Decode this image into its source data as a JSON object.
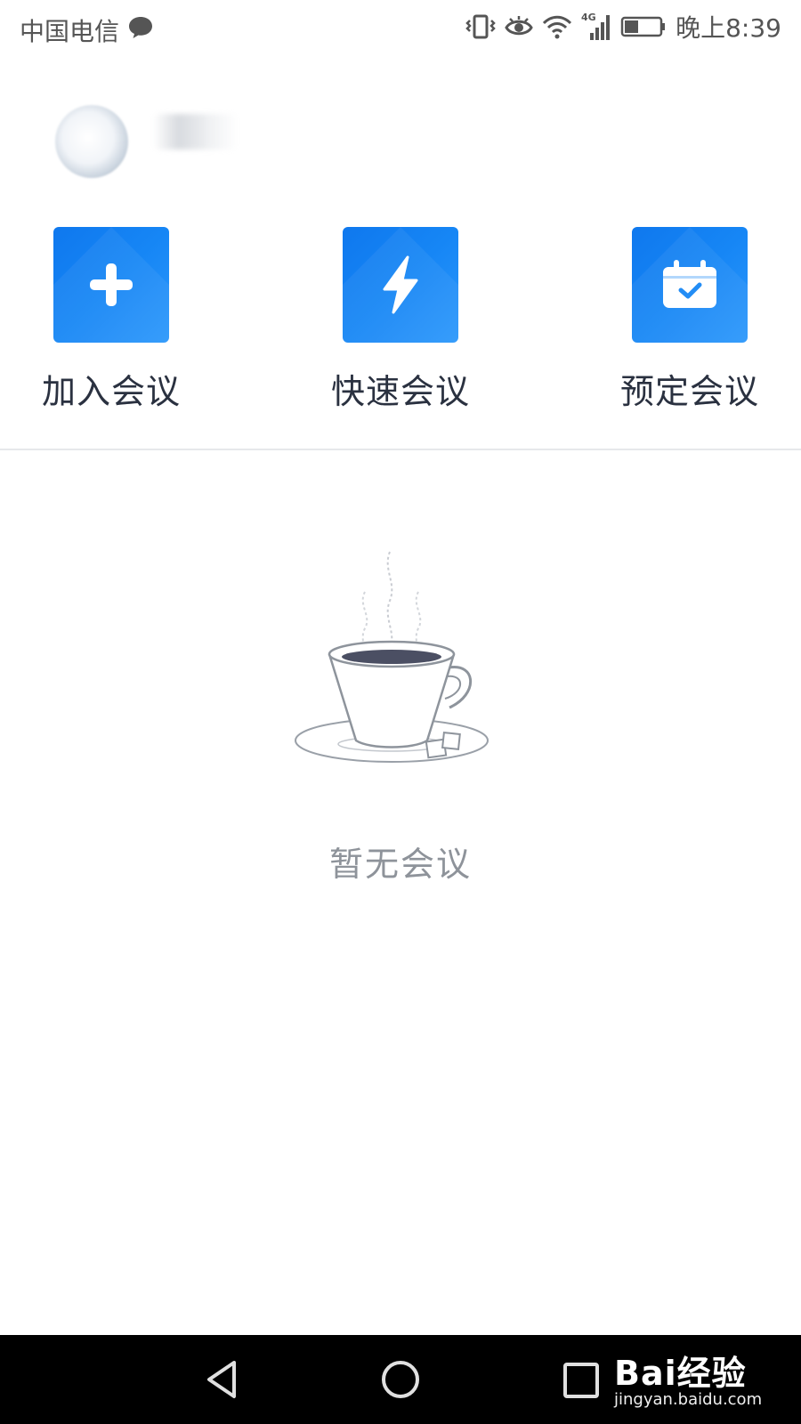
{
  "status_bar": {
    "carrier": "中国电信",
    "time": "晚上8:39",
    "network_label": "4G",
    "icons": [
      "message-icon",
      "vibrate-icon",
      "eye-icon",
      "wifi-icon",
      "signal-icon",
      "battery-icon"
    ]
  },
  "profile": {
    "avatar": "avatar-blurred",
    "name": ""
  },
  "actions": [
    {
      "label": "加入会议",
      "icon": "plus-icon"
    },
    {
      "label": "快速会议",
      "icon": "lightning-icon"
    },
    {
      "label": "预定会议",
      "icon": "calendar-check-icon"
    }
  ],
  "empty_state": {
    "icon": "coffee-cup-illustration",
    "text": "暂无会议"
  },
  "nav_bar": {
    "buttons": [
      "back-icon",
      "home-icon",
      "recent-apps-icon"
    ]
  },
  "watermark": {
    "brand": "Bai经验",
    "url": "jingyan.baidu.com"
  },
  "colors": {
    "accent": "#1686f5",
    "label_text": "#2a3140",
    "empty_text": "#8e939a",
    "nav_bg": "#000000"
  }
}
